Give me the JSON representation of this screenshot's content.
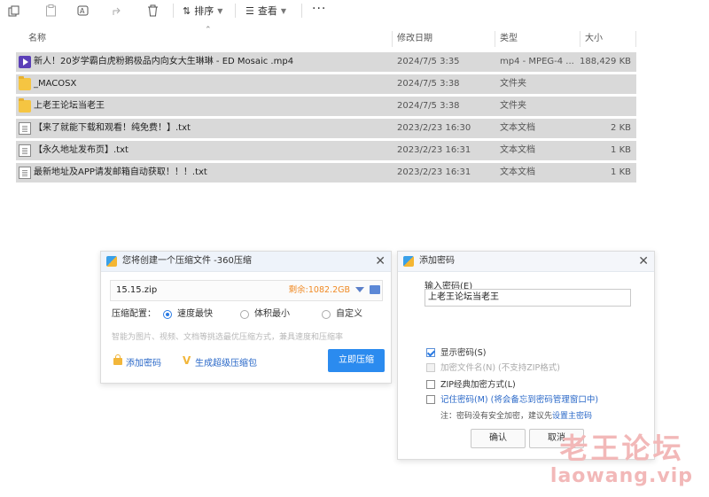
{
  "toolbar": {
    "sort_label": "排序",
    "view_label": "查看",
    "more_label": "···"
  },
  "columns": {
    "name": "名称",
    "date": "修改日期",
    "type": "类型",
    "size": "大小"
  },
  "files": [
    {
      "icon": "video-file-icon",
      "name": "新人！20岁学霸白虎粉鹅极品内向女大生琳琳 - ED Mosaic .mp4",
      "date": "2024/7/5 3:35",
      "type": "mp4 - MPEG-4 ...",
      "size": "188,429 KB"
    },
    {
      "icon": "folder-icon",
      "name": "_MACOSX",
      "date": "2024/7/5 3:38",
      "type": "文件夹",
      "size": ""
    },
    {
      "icon": "folder-icon",
      "name": "上老王论坛当老王",
      "date": "2024/7/5 3:38",
      "type": "文件夹",
      "size": ""
    },
    {
      "icon": "text-file-icon",
      "name": "【来了就能下载和观看！纯免费！】.txt",
      "date": "2023/2/23 16:30",
      "type": "文本文档",
      "size": "2 KB"
    },
    {
      "icon": "text-file-icon",
      "name": "【永久地址发布页】.txt",
      "date": "2023/2/23 16:31",
      "type": "文本文档",
      "size": "1 KB"
    },
    {
      "icon": "text-file-icon",
      "name": "最新地址及APP请发邮箱自动获取！！！.txt",
      "date": "2023/2/23 16:31",
      "type": "文本文档",
      "size": "1 KB"
    }
  ],
  "compress_dialog": {
    "title": "您将创建一个压缩文件 -360压缩",
    "filename": "15.15.zip",
    "remaining": "剩余:1082.2GB",
    "config_label": "压缩配置：",
    "options": [
      {
        "label": "速度最快",
        "selected": true
      },
      {
        "label": "体积最小",
        "selected": false
      },
      {
        "label": "自定义",
        "selected": false
      }
    ],
    "hint": "智能为图片、视频、文档等挑选最优压缩方式，兼具速度和压缩率",
    "add_password": "添加密码",
    "super_compress": "生成超级压缩包",
    "compress_now": "立即压缩"
  },
  "password_dialog": {
    "title": "添加密码",
    "input_label": "输入密码(E)",
    "password_value": "上老王论坛当老王",
    "checkboxes": [
      {
        "label": "显示密码(S)",
        "checked": true,
        "disabled": false
      },
      {
        "label": "加密文件名(N) (不支持ZIP格式)",
        "checked": false,
        "disabled": true
      },
      {
        "label": "ZIP经典加密方式(L)",
        "checked": false,
        "disabled": false
      },
      {
        "label": "记住密码(M) (将会备忘到密码管理窗口中)",
        "checked": false,
        "disabled": false
      }
    ],
    "note": "注：密码没有安全加密，建议先",
    "note_link": "设置主密码",
    "ok": "确认",
    "cancel": "取消"
  },
  "watermark": {
    "title": "老王论坛",
    "url": "laowang.vip"
  },
  "colors": {
    "row_bg": "#d9d9d9",
    "primary_button": "#2b8bef",
    "link": "#2a68c8",
    "remaining_space": "#f08a24",
    "watermark": "#f2b8b8"
  }
}
